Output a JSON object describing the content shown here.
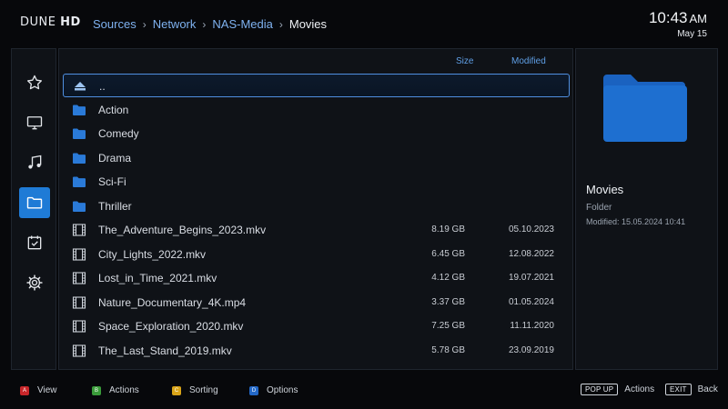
{
  "header": {
    "logo_main": "DUNE",
    "logo_suffix": "HD",
    "breadcrumb": [
      "Sources",
      "Network",
      "NAS-Media",
      "Movies"
    ],
    "clock_time": "10:43",
    "clock_ampm": "AM",
    "clock_date": "May 15"
  },
  "sidebar": {
    "items": [
      {
        "icon": "star-icon",
        "label": "Favorites",
        "active": false
      },
      {
        "icon": "tv-icon",
        "label": "TV",
        "active": false
      },
      {
        "icon": "music-icon",
        "label": "Music",
        "active": false
      },
      {
        "icon": "folder-icon",
        "label": "Sources",
        "active": true
      },
      {
        "icon": "task-icon",
        "label": "Tasks",
        "active": false
      },
      {
        "icon": "gear-icon",
        "label": "Settings",
        "active": false
      }
    ]
  },
  "file_list": {
    "col_size": "Size",
    "col_modified": "Modified",
    "rows": [
      {
        "type": "up",
        "name": "..",
        "size": "",
        "modified": "",
        "selected": true
      },
      {
        "type": "folder",
        "name": "Action",
        "size": "",
        "modified": ""
      },
      {
        "type": "folder",
        "name": "Comedy",
        "size": "",
        "modified": ""
      },
      {
        "type": "folder",
        "name": "Drama",
        "size": "",
        "modified": ""
      },
      {
        "type": "folder",
        "name": "Sci-Fi",
        "size": "",
        "modified": ""
      },
      {
        "type": "folder",
        "name": "Thriller",
        "size": "",
        "modified": ""
      },
      {
        "type": "video",
        "name": "The_Adventure_Begins_2023.mkv",
        "size": "8.19 GB",
        "modified": "05.10.2023"
      },
      {
        "type": "video",
        "name": "City_Lights_2022.mkv",
        "size": "6.45 GB",
        "modified": "12.08.2022"
      },
      {
        "type": "video",
        "name": "Lost_in_Time_2021.mkv",
        "size": "4.12 GB",
        "modified": "19.07.2021"
      },
      {
        "type": "video",
        "name": "Nature_Documentary_4K.mp4",
        "size": "3.37 GB",
        "modified": "01.05.2024"
      },
      {
        "type": "video",
        "name": "Space_Exploration_2020.mkv",
        "size": "7.25 GB",
        "modified": "11.11.2020"
      },
      {
        "type": "video",
        "name": "The_Last_Stand_2019.mkv",
        "size": "5.78 GB",
        "modified": "23.09.2019"
      }
    ]
  },
  "info": {
    "title": "Movies",
    "type": "Folder",
    "modified": "Modified: 15.05.2024 10:41"
  },
  "footer": {
    "hints": [
      {
        "key": "A",
        "label": "View",
        "color": "#c8262a"
      },
      {
        "key": "B",
        "label": "Actions",
        "color": "#3a9c3a"
      },
      {
        "key": "C",
        "label": "Sorting",
        "color": "#d9a418"
      },
      {
        "key": "D",
        "label": "Options",
        "color": "#2368c7"
      }
    ],
    "popup_key": "POP UP",
    "popup_label": "Actions",
    "exit_key": "EXIT",
    "exit_label": "Back"
  },
  "colors": {
    "accent": "#1f7bd6",
    "folder": "#1e6fd0",
    "header_text": "#5f9fe6"
  }
}
